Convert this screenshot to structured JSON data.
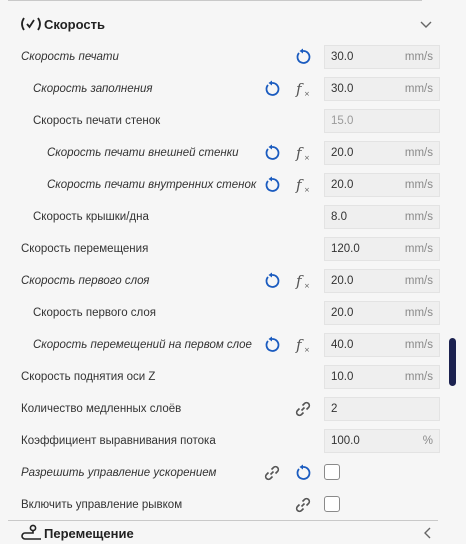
{
  "speed_section": {
    "title": "Скорость"
  },
  "travel_section": {
    "title": "Перемещение"
  },
  "rows": [
    {
      "label": "Скорость печати",
      "value": "30.0",
      "unit": "mm/s"
    },
    {
      "label": "Скорость заполнения",
      "value": "30.0",
      "unit": "mm/s"
    },
    {
      "label": "Скорость печати стенок",
      "value": "15.0",
      "unit": ""
    },
    {
      "label": "Скорость печати внешней стенки",
      "value": "20.0",
      "unit": "mm/s"
    },
    {
      "label": "Скорость печати внутренних стенок",
      "value": "20.0",
      "unit": "mm/s"
    },
    {
      "label": "Скорость крышки/дна",
      "value": "8.0",
      "unit": "mm/s"
    },
    {
      "label": "Скорость перемещения",
      "value": "120.0",
      "unit": "mm/s"
    },
    {
      "label": "Скорость первого слоя",
      "value": "20.0",
      "unit": "mm/s"
    },
    {
      "label": "Скорость первого слоя",
      "value": "20.0",
      "unit": "mm/s"
    },
    {
      "label": "Скорость перемещений на первом слое",
      "value": "40.0",
      "unit": "mm/s"
    },
    {
      "label": "Скорость поднятия оси Z",
      "value": "10.0",
      "unit": "mm/s"
    },
    {
      "label": "Количество медленных слоёв",
      "value": "2",
      "unit": ""
    },
    {
      "label": "Коэффициент выравнивания потока",
      "value": "100.0",
      "unit": "%"
    },
    {
      "label": "Разрешить управление ускорением"
    },
    {
      "label": "Включить управление рывком"
    }
  ],
  "colors": {
    "accent": "#1a5bbf",
    "icon_gray": "#555555",
    "scrollbar": "#1c2250"
  },
  "icons": {
    "reset": "reset-icon",
    "formula": "function-icon",
    "link": "link-icon"
  }
}
